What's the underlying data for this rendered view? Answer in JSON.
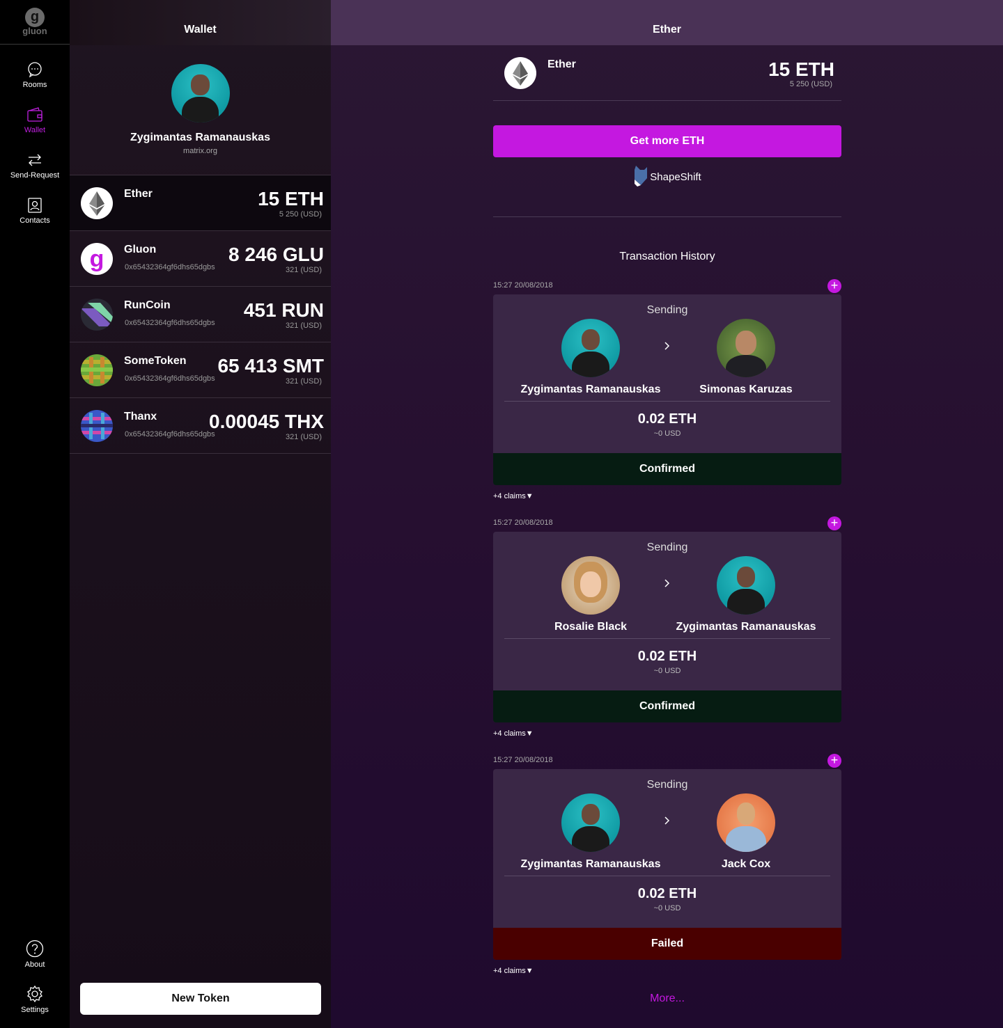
{
  "nav": {
    "logo_text": "gluon",
    "logo_letter": "g",
    "items": [
      {
        "label": "Rooms"
      },
      {
        "label": "Wallet"
      },
      {
        "label": "Send-Request"
      },
      {
        "label": "Contacts"
      },
      {
        "label": "About"
      },
      {
        "label": "Settings"
      }
    ],
    "active_color": "#c020e0"
  },
  "wallet": {
    "title": "Wallet",
    "user_name": "Zygimantas Ramanauskas",
    "server": "matrix.org",
    "tokens": [
      {
        "name": "Ether",
        "address": "",
        "amount": "15 ETH",
        "usd": "5 250 (USD)",
        "icon": "ethereum-icon"
      },
      {
        "name": "Gluon",
        "address": "0x65432364gf6dhs65dgbs",
        "amount": "8 246 GLU",
        "usd": "321 (USD)",
        "icon": "gluon-icon"
      },
      {
        "name": "RunCoin",
        "address": "0x65432364gf6dhs65dgbs",
        "amount": "451 RUN",
        "usd": "321 (USD)",
        "icon": "runcoin-icon"
      },
      {
        "name": "SomeToken",
        "address": "0x65432364gf6dhs65dgbs",
        "amount": "65 413 SMT",
        "usd": "321 (USD)",
        "icon": "sometoken-icon"
      },
      {
        "name": "Thanx",
        "address": "0x65432364gf6dhs65dgbs",
        "amount": "0.00045 THX",
        "usd": "321 (USD)",
        "icon": "thanx-icon"
      }
    ],
    "new_token_label": "New Token"
  },
  "main": {
    "title": "Ether",
    "token_name": "Ether",
    "amount": "15 ETH",
    "usd": "5 250 (USD)",
    "get_more_label": "Get more ETH",
    "shapeshift_label": "ShapeShift",
    "history_title": "Transaction History",
    "transactions": [
      {
        "date": "15:27 20/08/2018",
        "label": "Sending",
        "from": "Zygimantas Ramanauskas",
        "to": "Simonas Karuzas",
        "amount": "0.02 ETH",
        "usd": "~0 USD",
        "status": "Confirmed",
        "claims": "+4 claims▼"
      },
      {
        "date": "15:27 20/08/2018",
        "label": "Sending",
        "from": "Rosalie Black",
        "to": "Zygimantas Ramanauskas",
        "amount": "0.02 ETH",
        "usd": "~0 USD",
        "status": "Confirmed",
        "claims": "+4 claims▼"
      },
      {
        "date": "15:27 20/08/2018",
        "label": "Sending",
        "from": "Zygimantas Ramanauskas",
        "to": "Jack Cox",
        "amount": "0.02 ETH",
        "usd": "~0 USD",
        "status": "Failed",
        "claims": "+4 claims▼"
      }
    ],
    "more_label": "More...",
    "colors": {
      "accent": "#c418e0",
      "confirmed": "#061c12",
      "failed": "#4a0000"
    }
  }
}
